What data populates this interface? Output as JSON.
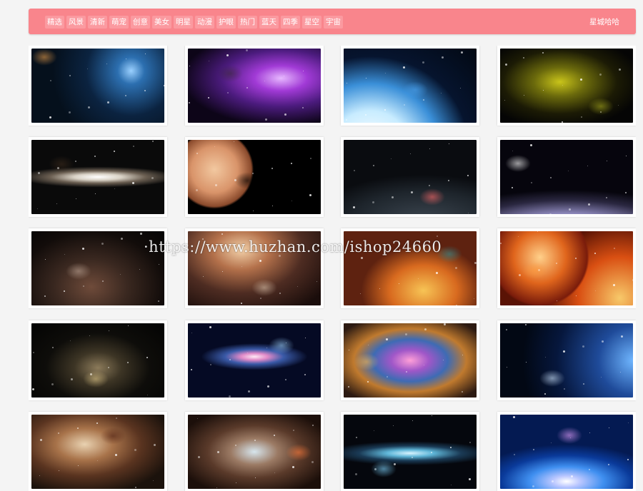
{
  "nav": {
    "categories": [
      "精选",
      "风景",
      "清新",
      "萌宠",
      "创意",
      "美女",
      "明星",
      "动漫",
      "护眼",
      "热门",
      "蓝天",
      "四季",
      "星空",
      "宇宙"
    ],
    "brand": "星城哈哈"
  },
  "watermark": "·https://www.huzhan.com/ishop24660",
  "gallery": {
    "items": [
      {
        "name": "nebula-ships-wallpaper",
        "bg": "radial-gradient(circle at 75% 30%, #9ad0ff 0%, #2c6fb0 12%, #0b2340 40%, #05101c 70%), linear-gradient(135deg,#1a3657,#05101c)",
        "accent": "#e59b4a"
      },
      {
        "name": "purple-nebula-planet-wallpaper",
        "bg": "radial-gradient(ellipse at 70% 40%, #e7b8ff 0%, #a13ad6 20%, #4b1b7d 45%, #0d0518 75%)",
        "accent": "#3b2a3c"
      },
      {
        "name": "blue-planet-horizon-wallpaper",
        "bg": "radial-gradient(ellipse at 20% 130%, #ffffff 0%, #c8ecff 25%, #3a8fd8 45%, #06142e 65%, #020812 100%)",
        "accent": "#4aa3f0"
      },
      {
        "name": "yellow-nebula-wallpaper",
        "bg": "radial-gradient(ellipse at 45% 45%, #c9c41a 0%, #6b6a0c 25%, #1c1b05 55%, #050505 80%)",
        "accent": "#a5a71c"
      },
      {
        "name": "sombrero-galaxy-wallpaper",
        "bg": "radial-gradient(ellipse 60% 14% at 50% 50%, #ffffff 0%, #d9d2c6 30%, #6b5f52 60%, #0a0a0a 100%)",
        "accent": "#3b2a1c"
      },
      {
        "name": "orange-planets-wallpaper",
        "bg": "radial-gradient(circle at 20% 40%, #f2c8a0 0%, #d9946a 20%, #8a4a2c 32%, #000 34%), radial-gradient(circle at 85% 75%, #cfd8de 0%, #7f8b92 14%, #000 16%)",
        "accent": "#000"
      },
      {
        "name": "ringed-planet-wallpaper",
        "bg": "radial-gradient(ellipse 120% 90% at 60% 110%, #3c4650 0%, #1e252c 45%, #0a0c10 70%), linear-gradient(160deg, transparent 40%, #ff5a5a 48%, transparent 52%)",
        "accent": "#ff6a6a"
      },
      {
        "name": "purple-planet-horizon-wallpaper",
        "bg": "radial-gradient(ellipse 140% 70% at 50% 120%, #dad6ef 0%, #8b86b9 30%, #2a2740 55%, #06050d 75%)",
        "accent": "#ffffff"
      },
      {
        "name": "alien-ship-wallpaper",
        "bg": "radial-gradient(ellipse at 45% 75%, #6f4b3a 0%, #3a2820 35%, #120c0a 70%, #050404 100%)",
        "accent": "#bca393"
      },
      {
        "name": "asteroid-field-wallpaper",
        "bg": "radial-gradient(ellipse at 40% 25%, #f3d1a9 0%, #b4714b 25%, #4e2c22 55%, #1a0d0b 90%)",
        "accent": "#d8c0a8"
      },
      {
        "name": "fiery-earth-wallpaper",
        "bg": "radial-gradient(ellipse at 60% 80%, #f7c455 0%, #d86a1f 30%, #5e2210 55%), radial-gradient(circle at 15% 45%, #f0b35a 0%, #b9521a 20%, transparent 22%), linear-gradient(135deg,#f39a2a,#3a0f08)",
        "accent": "#2e8a8f"
      },
      {
        "name": "red-planets-wallpaper",
        "bg": "radial-gradient(circle at 30% 35%, #ffd08a 0%, #e0651c 25%, #7a1c0b 45%, transparent 47%), radial-gradient(circle at 90% 90%, #f7c96a 0%, #d94f12 30%, #5a1305 55%), #1a0404",
        "accent": "#ff9a3c"
      },
      {
        "name": "golden-dust-wallpaper",
        "bg": "radial-gradient(ellipse at 50% 60%, #8b7a5a 0%, #3d3525 25%, #0e0d0a 55%, #030303 100%)",
        "accent": "#d8c083"
      },
      {
        "name": "spiral-galaxy-wallpaper",
        "bg": "radial-gradient(ellipse 40% 18% at 50% 45%, #ffe9f5 0%, #e08ac8 25%, #3a5aa8 55%, #050a24 100%)",
        "accent": "#9ad0ff"
      },
      {
        "name": "colorful-nebula-wallpaper",
        "bg": "radial-gradient(ellipse at 50% 50%, #ff9fd8 0%, #a057c8 20%, #3e6bb4 40%, #c07a2e 60%, #2c1a12 90%)",
        "accent": "#f2b452"
      },
      {
        "name": "deep-blue-planet-wallpaper",
        "bg": "radial-gradient(circle at 100% 50%, #6fb6ff 0%, #1f4b9a 25%, #06173d 55%, #020814 80%)",
        "accent": "#cfe6ff"
      },
      {
        "name": "brown-nebula-wallpaper",
        "bg": "radial-gradient(ellipse at 40% 40%, #e9d2b1 0%, #a8734a 25%, #5a3420 50%, #1b120c 80%)",
        "accent": "#4d1f12"
      },
      {
        "name": "cosmic-explosion-wallpaper",
        "bg": "radial-gradient(ellipse at 50% 50%, #d7e6ee 0%, #9b7a64 25%, #5a3a2a 50%, #1c0f0a 85%)",
        "accent": "#ff7a3a"
      },
      {
        "name": "blue-galaxy-band-wallpaper",
        "bg": "radial-gradient(ellipse 70% 18% at 50% 52%, #d9f4ff 0%, #5fb6d8 25%, #1a3a55 55%, #05070d 90%)",
        "accent": "#7fd4ff"
      },
      {
        "name": "light-burst-wallpaper",
        "bg": "radial-gradient(ellipse 70% 50% at 50% 90%, #ffffff 0%, #b9c6ff 15%, #3f8ff0 40%, #0a3a9a 70%, #041a52 100%)",
        "accent": "#e7a0ff"
      }
    ]
  }
}
